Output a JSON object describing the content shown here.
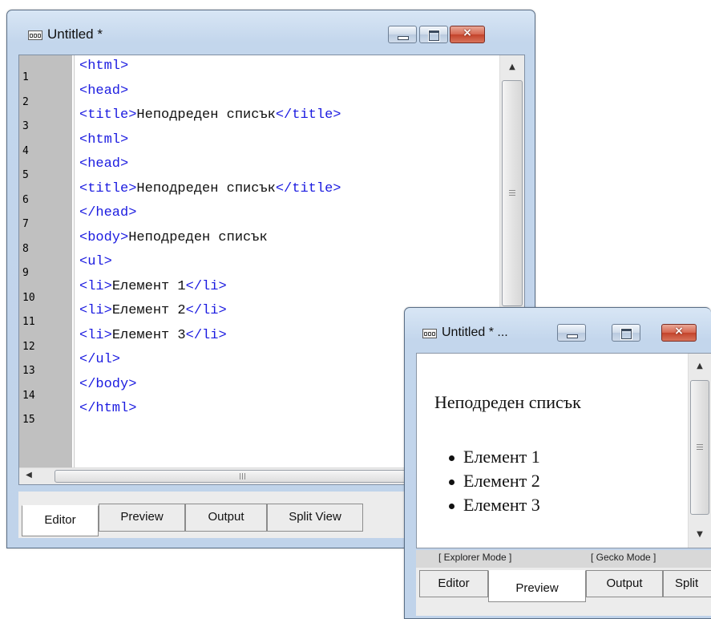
{
  "editor_window": {
    "title": "Untitled *",
    "icon": "html-document-icon",
    "caption_buttons": {
      "minimize": "minimize-icon",
      "maximize": "maximize-icon",
      "close": "×"
    },
    "line_numbers": [
      "1",
      "2",
      "3",
      "4",
      "5",
      "6",
      "7",
      "8",
      "9",
      "10",
      "11",
      "12",
      "13",
      "14",
      "15"
    ],
    "code_lines": [
      [
        {
          "t": "tag",
          "s": "<html>"
        }
      ],
      [
        {
          "t": "tag",
          "s": "<head>"
        }
      ],
      [
        {
          "t": "tag",
          "s": "<title>"
        },
        {
          "t": "txt",
          "s": "Неподреден списък"
        },
        {
          "t": "tag",
          "s": "</title>"
        }
      ],
      [
        {
          "t": "tag",
          "s": "<html>"
        }
      ],
      [
        {
          "t": "tag",
          "s": "<head>"
        }
      ],
      [
        {
          "t": "tag",
          "s": "<title>"
        },
        {
          "t": "txt",
          "s": "Неподреден списък"
        },
        {
          "t": "tag",
          "s": "</title>"
        }
      ],
      [
        {
          "t": "tag",
          "s": "</head>"
        }
      ],
      [
        {
          "t": "tag",
          "s": "<body>"
        },
        {
          "t": "txt",
          "s": "Неподреден списък"
        }
      ],
      [
        {
          "t": "tag",
          "s": "<ul>"
        }
      ],
      [
        {
          "t": "tag",
          "s": "<li>"
        },
        {
          "t": "txt",
          "s": "Елемент 1"
        },
        {
          "t": "tag",
          "s": "</li>"
        }
      ],
      [
        {
          "t": "tag",
          "s": "<li>"
        },
        {
          "t": "txt",
          "s": "Елемент 2"
        },
        {
          "t": "tag",
          "s": "</li>"
        }
      ],
      [
        {
          "t": "tag",
          "s": "<li>"
        },
        {
          "t": "txt",
          "s": "Елемент 3"
        },
        {
          "t": "tag",
          "s": "</li>"
        }
      ],
      [
        {
          "t": "tag",
          "s": "</ul>"
        }
      ],
      [
        {
          "t": "tag",
          "s": "</body>"
        }
      ],
      [
        {
          "t": "tag",
          "s": "</html>"
        }
      ]
    ],
    "tabs": [
      {
        "label": "Editor",
        "active": true
      },
      {
        "label": "Preview",
        "active": false
      },
      {
        "label": "Output",
        "active": false
      },
      {
        "label": "Split View",
        "active": false
      }
    ],
    "hscroll_grip": "III",
    "colors": {
      "tag": "#1b1be0",
      "text": "#111111",
      "gutter": "#c0c0c0"
    }
  },
  "preview_window": {
    "title": "Untitled * ...",
    "icon": "html-document-icon",
    "caption_buttons": {
      "minimize": "minimize-icon",
      "maximize": "maximize-icon",
      "close": "×"
    },
    "heading": "Неподреден списък",
    "list_items": [
      "Елемент 1",
      "Елемент 2",
      "Елемент 3"
    ],
    "modes": [
      "[ Explorer Mode ]",
      "[ Gecko Mode ]"
    ],
    "tabs": [
      {
        "label": "Editor",
        "active": false
      },
      {
        "label": "Preview",
        "active": true
      },
      {
        "label": "Output",
        "active": false
      },
      {
        "label": "Split",
        "active": false
      }
    ]
  }
}
